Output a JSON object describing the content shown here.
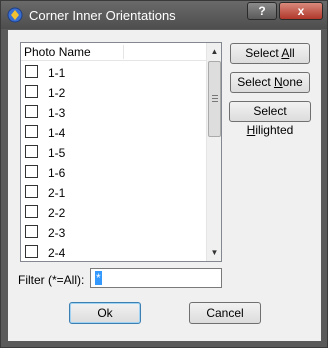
{
  "window": {
    "title": "Corner Inner Orientations"
  },
  "titlebar": {
    "help_label": "?",
    "close_label": "x"
  },
  "list": {
    "header": "Photo Name",
    "items": [
      {
        "label": "1-1",
        "checked": false
      },
      {
        "label": "1-2",
        "checked": false
      },
      {
        "label": "1-3",
        "checked": false
      },
      {
        "label": "1-4",
        "checked": false
      },
      {
        "label": "1-5",
        "checked": false
      },
      {
        "label": "1-6",
        "checked": false
      },
      {
        "label": "2-1",
        "checked": false
      },
      {
        "label": "2-2",
        "checked": false
      },
      {
        "label": "2-3",
        "checked": false
      },
      {
        "label": "2-4",
        "checked": false
      }
    ]
  },
  "buttons": {
    "select_all": "Select All",
    "select_all_pre": "Select ",
    "select_all_key": "A",
    "select_all_post": "ll",
    "select_none_pre": "Select ",
    "select_none_key": "N",
    "select_none_post": "one",
    "select_hilighted_pre": "Select ",
    "select_hilighted_key": "H",
    "select_hilighted_post": "ilighted",
    "ok": "Ok",
    "cancel": "Cancel"
  },
  "filter": {
    "label": "Filter (*=All):",
    "value": "*"
  }
}
